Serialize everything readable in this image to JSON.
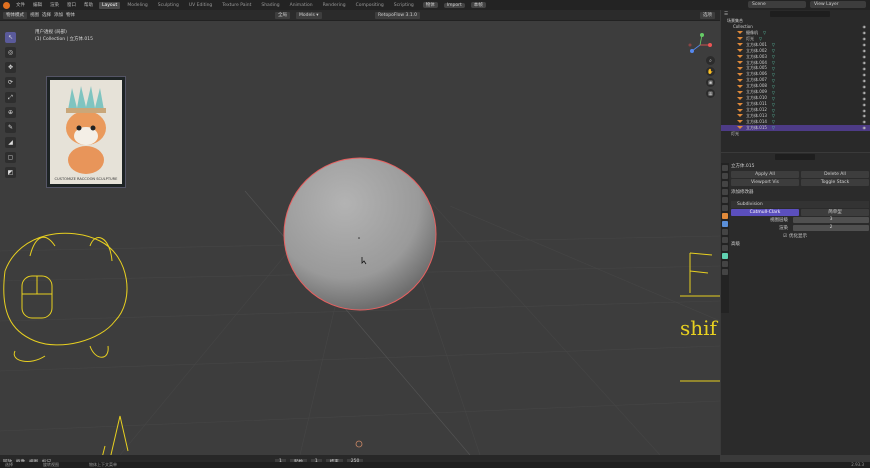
{
  "topbar": {
    "menus": [
      "文件",
      "编辑",
      "渲染",
      "窗口",
      "帮助"
    ],
    "workspaces": [
      "Layout",
      "Modeling",
      "Sculpting",
      "UV Editing",
      "Texture Paint",
      "Shading",
      "Animation",
      "Rendering",
      "Compositing",
      "Scripting"
    ],
    "active_workspace": "Layout",
    "pill1": "物体",
    "pill2": "Import",
    "pill3": "本帧",
    "scene": "Scene",
    "view_layer": "View Layer"
  },
  "header": {
    "mode": "物体模式",
    "view": "视图",
    "select": "选择",
    "add": "添加",
    "object": "物体",
    "global": "全局",
    "models": "Models ▾",
    "retopo": "RetopoFlow 3.1.0",
    "options": "选项"
  },
  "overlay": {
    "line1": "用户透视 (局部)",
    "line2": "(1) Collection | 立方体.015"
  },
  "image_caption": "CUSTOMIZE RACCOON SCULPTURE",
  "outliner": {
    "search_placeholder": "",
    "root": "场景集合",
    "collection": "Collection",
    "items": [
      "摄像机",
      "灯光",
      "立方体.001",
      "立方体.002",
      "立方体.003",
      "立方体.004",
      "立方体.005",
      "立方体.006",
      "立方体.007",
      "立方体.008",
      "立方体.009",
      "立方体.010",
      "立方体.011",
      "立方体.012",
      "立方体.013",
      "立方体.014",
      "立方体.015"
    ],
    "selected": "立方体.015",
    "extra": "灯光"
  },
  "properties": {
    "object": "立方体.015",
    "apply_all": "Apply All",
    "delete_all": "Delete All",
    "viewport_vis": "Viewport Vis",
    "toggle_stack": "Toggle Stack",
    "add_modifier": "添加修改器",
    "modifier_name": "Subdivision",
    "catmull": "Catmull-Clark",
    "simple": "简单型",
    "levels_viewport": "视图层级",
    "levels_viewport_val": "3",
    "render": "渲染",
    "render_val": "2",
    "optimal": "优化显示",
    "advanced": "高级"
  },
  "bottom": {
    "playback": "回放",
    "keying": "抠像",
    "view": "视图",
    "marker": "标记",
    "frame_start": "1",
    "start": "起始",
    "end": "结束",
    "end_val": "250",
    "current": "1"
  },
  "status": {
    "left": "选择",
    "mid": "旋转视图",
    "right": "物体上下文菜单",
    "version": "2.93.3"
  },
  "annotations": {
    "right_letter": "F",
    "right_text": "shif"
  },
  "colors": {
    "accent": "#5b4fbd",
    "selection_outline": "#e86060",
    "annotation": "#e8d020"
  }
}
